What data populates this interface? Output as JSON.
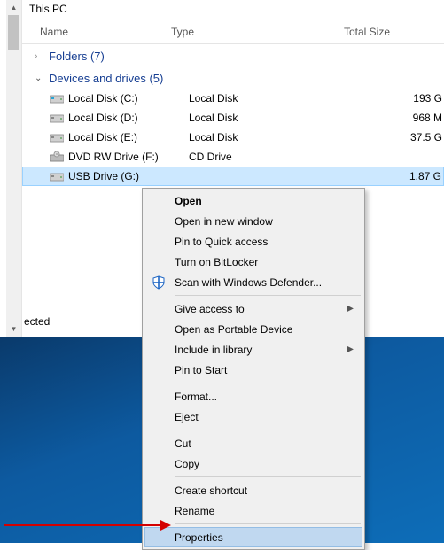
{
  "location": "This PC",
  "columns": {
    "name": "Name",
    "type": "Type",
    "size": "Total Size"
  },
  "groups": {
    "folders": {
      "label": "Folders (7)",
      "expanded": false
    },
    "drives": {
      "label": "Devices and drives (5)",
      "expanded": true
    }
  },
  "drives": [
    {
      "name": "Local Disk (C:)",
      "type": "Local Disk",
      "size": "193 G",
      "iconColor": "#2aa4d4"
    },
    {
      "name": "Local Disk (D:)",
      "type": "Local Disk",
      "size": "968 M",
      "iconColor": "#888"
    },
    {
      "name": "Local Disk (E:)",
      "type": "Local Disk",
      "size": "37.5 G",
      "iconColor": "#888"
    },
    {
      "name": "DVD RW Drive (F:)",
      "type": "CD Drive",
      "size": "",
      "iconColor": "#888"
    },
    {
      "name": "USB Drive (G:)",
      "type": "",
      "size": "1.87 G",
      "iconColor": "#888",
      "selected": true
    }
  ],
  "statusbar_fragment": "ected",
  "context_menu": {
    "groups": [
      [
        {
          "label": "Open",
          "bold": true
        },
        {
          "label": "Open in new window"
        },
        {
          "label": "Pin to Quick access"
        },
        {
          "label": "Turn on BitLocker"
        },
        {
          "label": "Scan with Windows Defender...",
          "icon": "defender"
        }
      ],
      [
        {
          "label": "Give access to",
          "submenu": true
        },
        {
          "label": "Open as Portable Device"
        },
        {
          "label": "Include in library",
          "submenu": true
        },
        {
          "label": "Pin to Start"
        }
      ],
      [
        {
          "label": "Format..."
        },
        {
          "label": "Eject"
        }
      ],
      [
        {
          "label": "Cut"
        },
        {
          "label": "Copy"
        }
      ],
      [
        {
          "label": "Create shortcut"
        },
        {
          "label": "Rename"
        }
      ],
      [
        {
          "label": "Properties",
          "hover": true
        }
      ]
    ]
  }
}
